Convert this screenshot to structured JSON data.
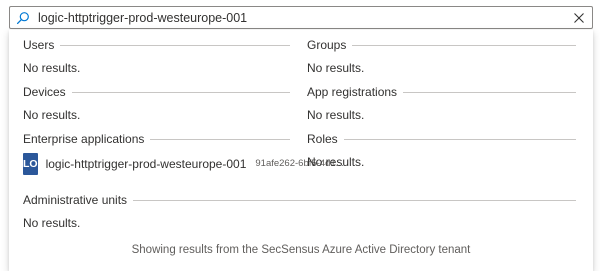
{
  "search": {
    "value": "logic-httptrigger-prod-westeurope-001",
    "icon": "search-icon",
    "clear_icon": "close-icon"
  },
  "sections": {
    "users": {
      "title": "Users",
      "empty": "No results."
    },
    "groups": {
      "title": "Groups",
      "empty": "No results."
    },
    "devices": {
      "title": "Devices",
      "empty": "No results."
    },
    "app_registrations": {
      "title": "App registrations",
      "empty": "No results."
    },
    "enterprise_applications": {
      "title": "Enterprise applications",
      "results": [
        {
          "initials": "LO",
          "name": "logic-httptrigger-prod-westeurope-001",
          "id": "91afe262-6bf5-4d1..."
        }
      ]
    },
    "roles": {
      "title": "Roles",
      "empty": "No results."
    },
    "administrative_units": {
      "title": "Administrative units",
      "empty": "No results."
    }
  },
  "footer": "Showing results from the SecSensus Azure Active Directory tenant",
  "colors": {
    "avatar": "#2b579a",
    "accent_icon": "#0078d4",
    "divider": "#c8c6c4"
  }
}
